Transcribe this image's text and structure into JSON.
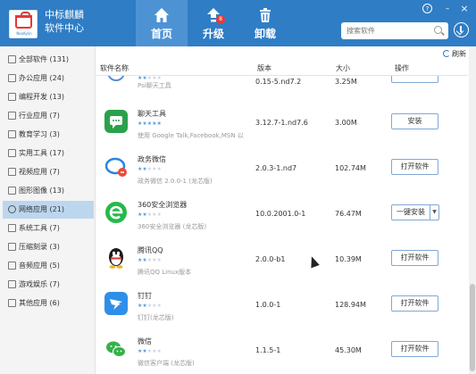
{
  "app": {
    "logo_text": "NeoKylin",
    "title_line1": "中标麒麟",
    "title_line2": "软件中心"
  },
  "nav": {
    "tabs": [
      {
        "label": "首页",
        "icon": "home-icon"
      },
      {
        "label": "升级",
        "icon": "upgrade-icon",
        "badge": "8"
      },
      {
        "label": "卸载",
        "icon": "trash-icon"
      }
    ]
  },
  "window_buttons": {
    "help": "?",
    "minimize": "–",
    "close": "×"
  },
  "search": {
    "placeholder": "搜索软件"
  },
  "sidebar": {
    "items": [
      {
        "label": "全部软件 (131)"
      },
      {
        "label": "办公应用 (24)"
      },
      {
        "label": "编程开发 (13)"
      },
      {
        "label": "行业应用 (7)"
      },
      {
        "label": "教育学习 (3)"
      },
      {
        "label": "实用工具 (17)"
      },
      {
        "label": "视频应用 (7)"
      },
      {
        "label": "图形图像 (13)"
      },
      {
        "label": "网络应用 (21)"
      },
      {
        "label": "系统工具 (7)"
      },
      {
        "label": "压缩刻录 (3)"
      },
      {
        "label": "音频应用 (5)"
      },
      {
        "label": "游戏娱乐 (7)"
      },
      {
        "label": "其他应用 (6)"
      }
    ]
  },
  "toolbar": {
    "refresh_label": "刷新"
  },
  "table": {
    "headers": {
      "name": "软件名称",
      "version": "版本",
      "size": "大小",
      "action": "操作"
    },
    "rows": [
      {
        "name": "",
        "desc": "Psi聊天工具",
        "version": "0.15-5.nd7.2",
        "size": "3.25M",
        "action": "",
        "color": "#5b8ed6",
        "stars": 2
      },
      {
        "name": "聊天工具",
        "desc": "使用 Google Talk,Facebook,MSN 以",
        "version": "3.12.7-1.nd7.6",
        "size": "3.00M",
        "action": "安装",
        "color": "#2aa14b",
        "stars": 5
      },
      {
        "name": "政务微信",
        "desc": "政务微信 2.0.0-1 (龙芯版)",
        "version": "2.0.3-1.nd7",
        "size": "102.74M",
        "action": "打开软件",
        "color": "#2b84e2",
        "stars": 2
      },
      {
        "name": "360安全浏览器",
        "desc": "360安全浏览器 (龙芯版)",
        "version": "10.0.2001.0-1",
        "size": "76.47M",
        "action": "一键安装",
        "color": "#26b94a",
        "stars": 2
      },
      {
        "name": "腾讯QQ",
        "desc": "腾讯QQ Linux版本",
        "version": "2.0.0-b1",
        "size": "10.39M",
        "action": "打开软件",
        "color": "#1b1b1b",
        "stars": 2
      },
      {
        "name": "钉钉",
        "desc": "钉钉(龙芯版)",
        "version": "1.0.0-1",
        "size": "128.94M",
        "action": "打开软件",
        "color": "#2f8fe8",
        "stars": 2
      },
      {
        "name": "微信",
        "desc": "微信客户端 (龙芯版)",
        "version": "1.1.5-1",
        "size": "45.30M",
        "action": "打开软件",
        "color": "#35b248",
        "stars": 2
      }
    ]
  }
}
